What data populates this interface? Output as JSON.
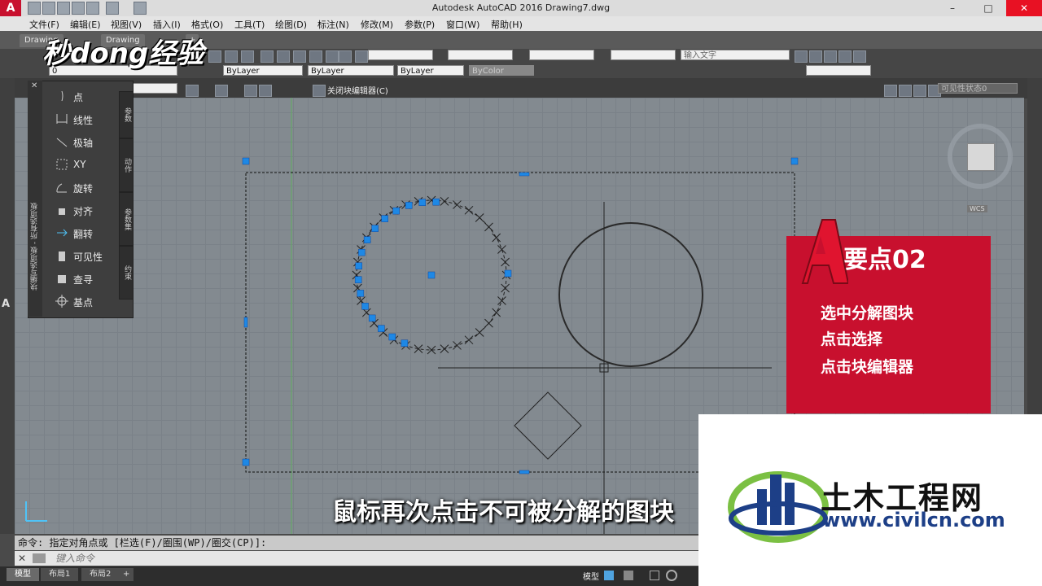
{
  "window": {
    "title": "Autodesk AutoCAD 2016    Drawing7.dwg",
    "app_logo": "A"
  },
  "menu": [
    "文件(F)",
    "编辑(E)",
    "视图(V)",
    "插入(I)",
    "格式(O)",
    "工具(T)",
    "绘图(D)",
    "标注(N)",
    "修改(M)",
    "参数(P)",
    "窗口(W)",
    "帮助(H)"
  ],
  "tabs": {
    "tab1": "Drawing",
    "tab2": "Drawing",
    "add": "+"
  },
  "toolbar": {
    "layer": "0",
    "color": "ByLayer",
    "linetype": "ByLayer",
    "lineweight": "ByLayer",
    "plotstyle": "ByColor",
    "search_placeholder": "输入文字",
    "block_editor_close": "关闭块编辑器(C)",
    "visibility_state": "可见性状态0"
  },
  "palette": {
    "items": [
      "点",
      "线性",
      "极轴",
      "XY",
      "旋转",
      "对齐",
      "翻转",
      "可见性",
      "查寻",
      "基点"
    ],
    "side_title": "块编写选项板 - 所有选项板",
    "tabs": [
      "参数",
      "动作",
      "参数集",
      "约束"
    ]
  },
  "card": {
    "heading": "要点02",
    "lines": [
      "选中分解图块",
      "点击选择",
      "点击块编辑器"
    ]
  },
  "subtitle": "鼠标再次点击不可被分解的图块",
  "brand_overlay": "秒dong经验",
  "watermark": {
    "name": "土木工程网",
    "url": "www.civilcn.com"
  },
  "command": {
    "history": "命令: 指定对角点或 [栏选(F)/圈围(WP)/圈交(CP)]:",
    "placeholder": "键入命令"
  },
  "layouts": [
    "模型",
    "布局1",
    "布局2"
  ],
  "status": {
    "model": "模型"
  },
  "viewcube": {
    "wcs": "WCS"
  },
  "colors": {
    "accent": "#c8102e",
    "grip": "#1e88e5",
    "canvas": "#838a90"
  }
}
